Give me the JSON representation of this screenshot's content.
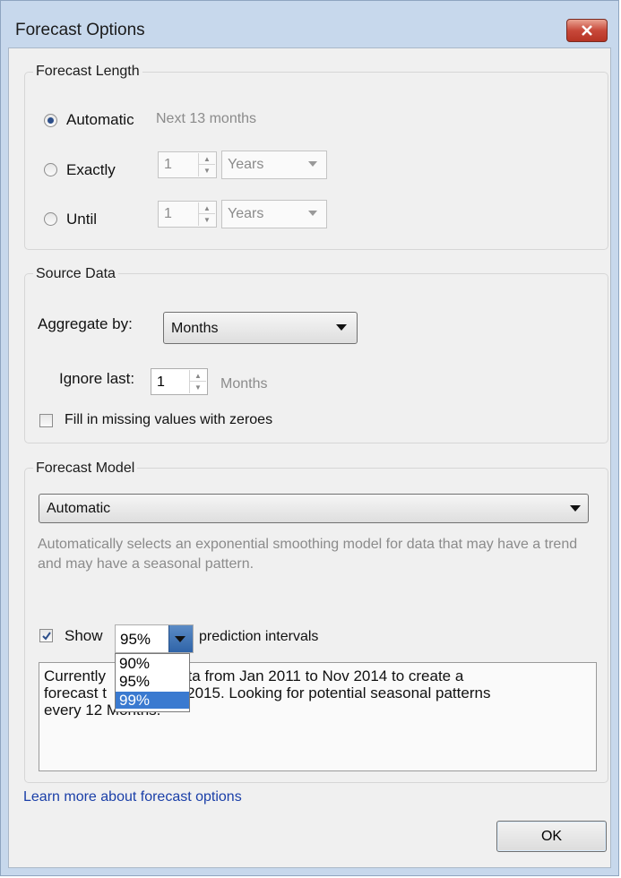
{
  "window": {
    "title": "Forecast Options"
  },
  "forecast_length": {
    "label": "Forecast Length",
    "options": [
      {
        "label": "Automatic",
        "selected": true,
        "hint": "Next 13 months"
      },
      {
        "label": "Exactly",
        "selected": false,
        "number": "1",
        "unit": "Years"
      },
      {
        "label": "Until",
        "selected": false,
        "number": "1",
        "unit": "Years"
      }
    ]
  },
  "source_data": {
    "label": "Source Data",
    "aggregate_label": "Aggregate by:",
    "aggregate_value": "Months",
    "ignore_label": "Ignore last:",
    "ignore_value": "1",
    "ignore_unit": "Months",
    "fill_label": "Fill in missing values with zeroes",
    "fill_checked": false
  },
  "forecast_model": {
    "label": "Forecast Model",
    "model_value": "Automatic",
    "description": "Automatically selects an exponential smoothing model for data that may have a trend and may have a seasonal pattern.",
    "show_label": "Show",
    "show_checked": true,
    "interval_value": "95%",
    "interval_suffix": "prediction intervals",
    "interval_options": [
      "90%",
      "95%",
      "99%"
    ],
    "interval_highlighted": "99%",
    "info_visible_lines": [
      "Currently",
      "ce data from Jan 2011 to Nov 2014 to create a",
      "forecast t",
      "c 2015. Looking for potential seasonal patterns",
      "every 12 Months."
    ]
  },
  "footer": {
    "link": "Learn more about forecast options",
    "ok_label": "OK"
  },
  "colors": {
    "title_bar": "#c7d8ec",
    "close_button": "#c8493a",
    "link": "#1a3fa8",
    "selection": "#3a7ad0"
  }
}
